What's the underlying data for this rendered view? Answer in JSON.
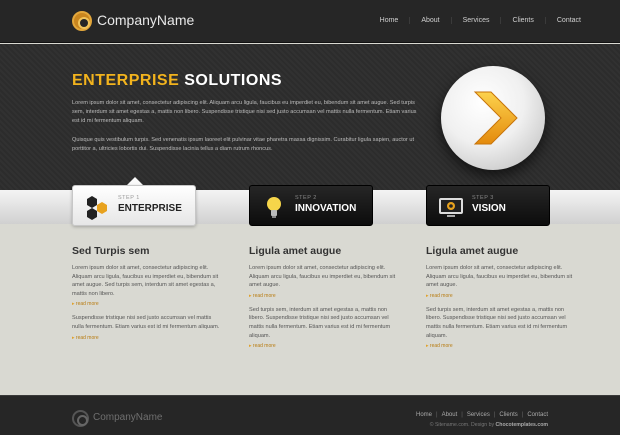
{
  "header": {
    "brand": "CompanyName",
    "nav": [
      "Home",
      "About",
      "Services",
      "Clients",
      "Contact"
    ]
  },
  "hero": {
    "title_highlight": "ENTERPRISE",
    "title_rest": "SOLUTIONS",
    "para1": "Lorem ipsum dolor sit amet, consectetur adipiscing elit. Aliquam arcu ligula, faucibus eu imperdiet eu, bibendum sit amet augue. Sed turpis sem, interdum sit amet egestas a, mattis non libero. Suspendisse tristique nisi sed justo accumsan vel mattis nulla fermentum. Etiam varius est id mi fermentum aliquam.",
    "para2": "Quisque quis vestibulum turpis. Sed venenatis ipsum laoreet elit pulvinar vitae pharetra massa dignissim. Curabitur ligula sapien, auctor ut porttitor a, ultricies lobortis dui. Suspendisse lacinia tellus a diam rutrum rhoncus.",
    "orb_icon": "chevron-right-icon"
  },
  "steps": [
    {
      "num": "STEP 1",
      "title": "ENTERPRISE",
      "icon": "hexagons-icon"
    },
    {
      "num": "STEP 2",
      "title": "INNOVATION",
      "icon": "lightbulb-icon"
    },
    {
      "num": "STEP 3",
      "title": "VISION",
      "icon": "monitor-icon"
    }
  ],
  "columns": [
    {
      "heading": "Sed Turpis sem",
      "p1": "Lorem ipsum dolor sit amet, consectetur adipiscing elit. Aliquam arcu ligula, faucibus eu imperdiet eu, bibendum sit amet augue. Sed turpis sem, interdum sit amet egestas a, mattis non libero.",
      "more1": "read more",
      "p2": "Suspendisse tristique nisi sed justo accumsan vel mattis nulla fermentum. Etiam varius est id mi fermentum aliquam.",
      "more2": "read more"
    },
    {
      "heading": "Ligula amet augue",
      "p1": "Lorem ipsum dolor sit amet, consectetur adipiscing elit. Aliquam arcu ligula, faucibus eu imperdiet eu, bibendum sit amet augue.",
      "more1": "read more",
      "p2": "Sed turpis sem, interdum sit amet egestas a, mattis non libero. Suspendisse tristique nisi sed justo accumsan vel mattis nulla fermentum. Etiam varius est id mi fermentum aliquam.",
      "more2": "read more"
    },
    {
      "heading": "Ligula amet augue",
      "p1": "Lorem ipsum dolor sit amet, consectetur adipiscing elit. Aliquam arcu ligula, faucibus eu imperdiet eu, bibendum sit amet augue.",
      "more1": "read more",
      "p2": "Sed turpis sem, interdum sit amet egestas a, mattis non libero. Suspendisse tristique nisi sed justo accumsan vel mattis nulla fermentum. Etiam varius est id mi fermentum aliquam.",
      "more2": "read more"
    }
  ],
  "footer": {
    "brand": "CompanyName",
    "nav": [
      "Home",
      "About",
      "Services",
      "Clients",
      "Contact"
    ],
    "copy_prefix": "© Sitename.com. Design by",
    "copy_link": "Chocotemplates.com"
  },
  "colors": {
    "accent": "#f2b31d",
    "header_bg": "#262626",
    "body_bg": "#d9d9d2"
  }
}
